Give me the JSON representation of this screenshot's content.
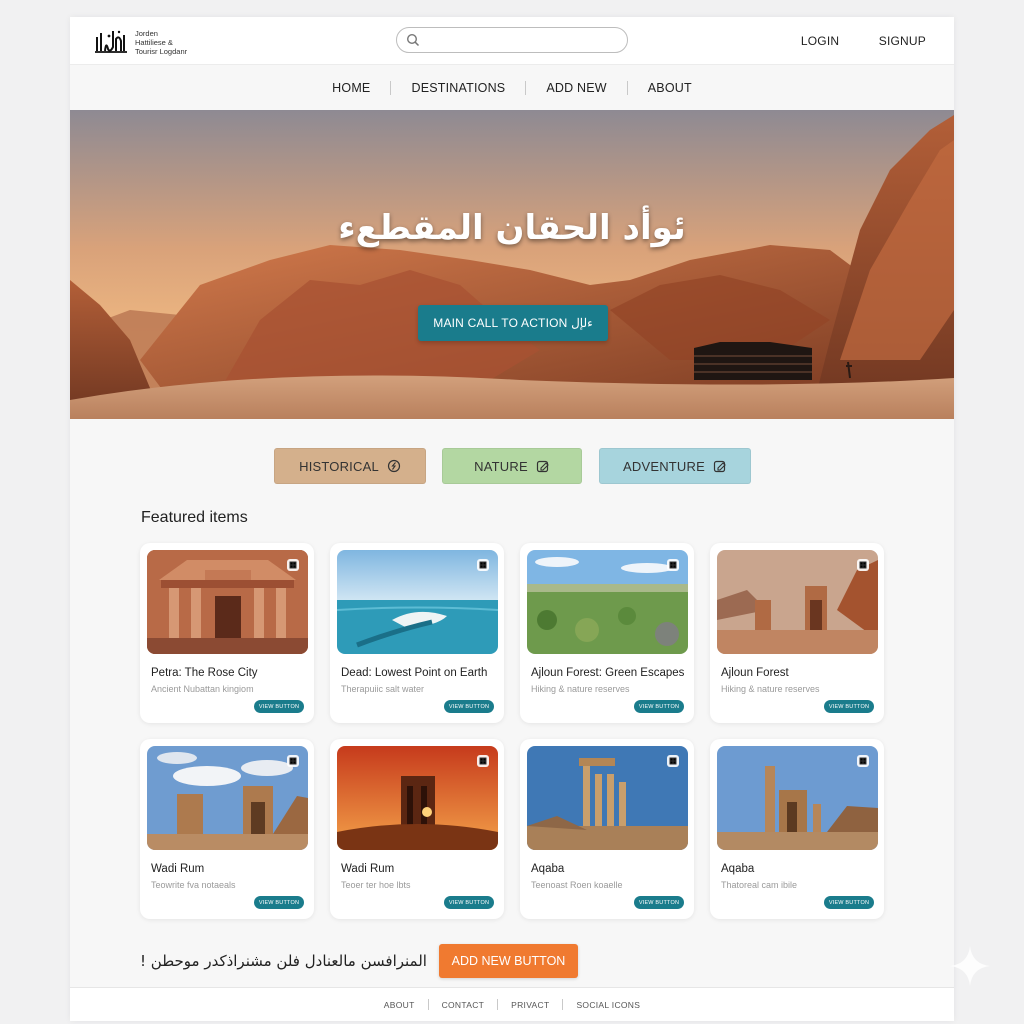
{
  "header": {
    "logo_lines": [
      "Jorden",
      "Hattiliese &",
      "Tourisr Logdanr"
    ],
    "search_placeholder": "",
    "login_label": "LOGIN",
    "signup_label": "SIGNUP"
  },
  "nav": {
    "items": [
      "HOME",
      "DESTINATIONS",
      "ADD NEW",
      "ABOUT"
    ]
  },
  "hero": {
    "title": "ئوأد الحقان المقطعء",
    "cta_label": "MAIN CALL TO ACTION ءلإل"
  },
  "categories": [
    {
      "label": "HISTORICAL",
      "color": "#d4b08c"
    },
    {
      "label": "NATURE",
      "color": "#b3d7a2"
    },
    {
      "label": "ADVENTURE",
      "color": "#a7d4dd"
    }
  ],
  "featured": {
    "heading": "Featured items",
    "items": [
      {
        "title": "Petra: The Rose City",
        "subtitle": "Ancient Nubattan kingiom",
        "button": "VIEW BUTTON",
        "image": "petra-treasury"
      },
      {
        "title": "Dead: Lowest Point on Earth",
        "subtitle": "Therapuiic salt water",
        "button": "VIEW BUTTON",
        "image": "dead-sea"
      },
      {
        "title": "Ajloun Forest: Green Escapes",
        "subtitle": "Hiking & nature reserves",
        "button": "VIEW BUTTON",
        "image": "ajloun-landscape"
      },
      {
        "title": "Ajloun Forest",
        "subtitle": "Hiking & nature reserves",
        "button": "VIEW BUTTON",
        "image": "desert-ruins"
      },
      {
        "title": "Wadi Rum",
        "subtitle": "Teowrite fva notaeals",
        "button": "VIEW BUTTON",
        "image": "ruins-clouds"
      },
      {
        "title": "Wadi Rum",
        "subtitle": "Teoer ter hoe lbts",
        "button": "VIEW BUTTON",
        "image": "sunset-ruins"
      },
      {
        "title": "Aqaba",
        "subtitle": "Teenoast Roen koaelle",
        "button": "VIEW BUTTON",
        "image": "jerash-columns"
      },
      {
        "title": "Aqaba",
        "subtitle": "Thatoreal cam ibile",
        "button": "VIEW BUTTON",
        "image": "temple-columns"
      }
    ]
  },
  "bottom": {
    "text": "المنرافسن مالعنادل فلن مشنراذكدر موحطن !",
    "add_button": "ADD NEW BUTTON"
  },
  "footer": {
    "items": [
      "ABOUT",
      "CONTACT",
      "PRIVACT",
      "SOCIAL ICONS"
    ]
  },
  "colors": {
    "accent": "#1a7c8c",
    "orange": "#f07a30"
  }
}
